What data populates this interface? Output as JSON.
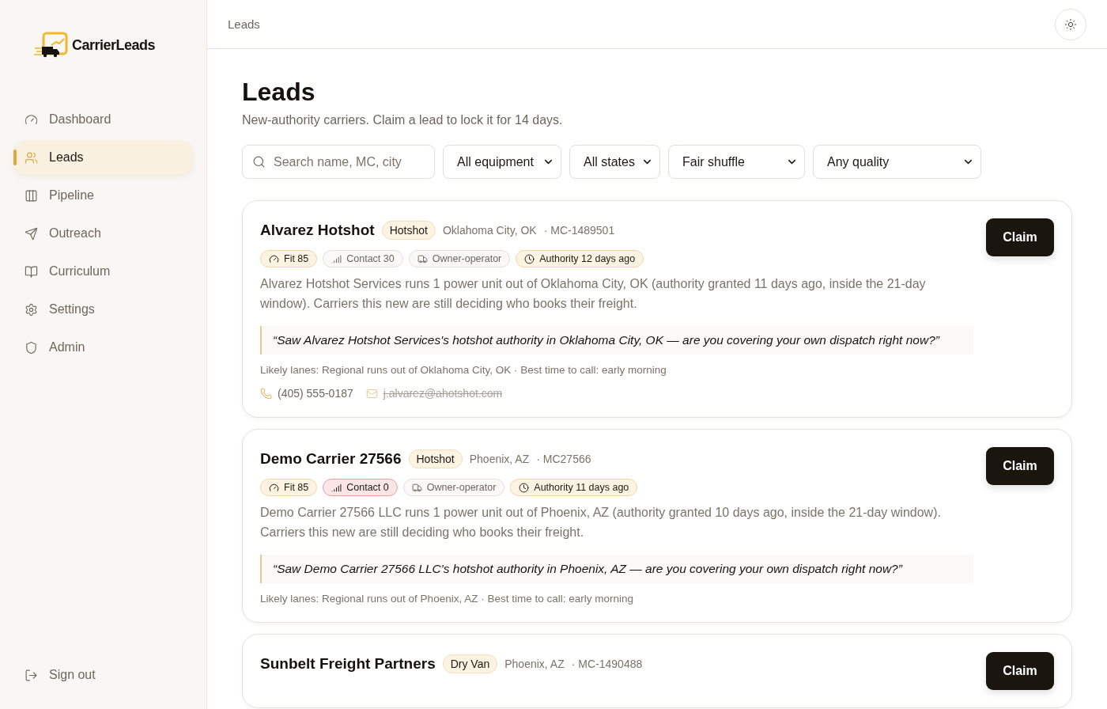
{
  "brand": {
    "name": "CarrierLeads"
  },
  "nav": [
    {
      "label": "Dashboard",
      "selected": false
    },
    {
      "label": "Leads",
      "selected": true
    },
    {
      "label": "Pipeline",
      "selected": false
    },
    {
      "label": "Outreach",
      "selected": false
    },
    {
      "label": "Curriculum",
      "selected": false
    },
    {
      "label": "Settings",
      "selected": false
    },
    {
      "label": "Admin",
      "selected": false
    }
  ],
  "sign_out": {
    "label": "Sign out"
  },
  "topbar": {
    "breadcrumb": "Leads"
  },
  "page": {
    "title": "Leads",
    "subtitle": "New-authority carriers. Claim a lead to lock it for 14 days."
  },
  "filters": {
    "search": {
      "placeholder": "Search name, MC, city"
    },
    "selects": [
      {
        "value": "All equipment"
      },
      {
        "value": "All states"
      },
      {
        "value": "Fair shuffle"
      },
      {
        "value": "Any quality"
      }
    ]
  },
  "leads": [
    {
      "name": "Alvarez Hotshot",
      "equipment": "Hotshot",
      "location": "Oklahoma City, OK",
      "mc": "· MC-1489501",
      "action": "Claim",
      "chips": [
        {
          "kind": "fit",
          "label": "Fit 85",
          "color": "#efd8a8"
        },
        {
          "kind": "contact",
          "label": "Contact 30",
          "color": "#e4e0da"
        },
        {
          "kind": "operator",
          "label": "Owner-operator",
          "color": "#e4e0da"
        },
        {
          "kind": "authority",
          "label": "Authority 12 days ago",
          "color": "#efd8a8"
        }
      ],
      "summary": "Alvarez Hotshot Services runs 1 power unit out of Oklahoma City, OK (authority granted 11 days ago, inside the 21-day window). Carriers this new are still deciding who books their freight.",
      "pitch": "“Saw Alvarez Hotshot Services's hotshot authority in Oklahoma City, OK — are you covering your own dispatch right now?”",
      "lanes": "Likely lanes: Regional runs out of Oklahoma City, OK · Best time to call: early morning",
      "phone": "(405) 555-0187",
      "email": {
        "address": "j.alvarez@ahotshot.com",
        "struck": true
      }
    },
    {
      "name": "Demo Carrier 27566",
      "equipment": "Hotshot",
      "location": "Phoenix, AZ",
      "mc": "· MC27566",
      "action": "Claim",
      "chips": [
        {
          "kind": "fit",
          "label": "Fit 85",
          "color": "#efd8a8"
        },
        {
          "kind": "contact",
          "label": "Contact 0",
          "color": "#e89ea3"
        },
        {
          "kind": "operator",
          "label": "Owner-operator",
          "color": "#e4e0da"
        },
        {
          "kind": "authority",
          "label": "Authority 11 days ago",
          "color": "#efd8a8"
        }
      ],
      "summary": "Demo Carrier 27566 LLC runs 1 power unit out of Phoenix, AZ (authority granted 10 days ago, inside the 21-day window). Carriers this new are still deciding who books their freight.",
      "pitch": "“Saw Demo Carrier 27566 LLC's hotshot authority in Phoenix, AZ — are you covering your own dispatch right now?”",
      "lanes": "Likely lanes: Regional runs out of Phoenix, AZ · Best time to call: early morning"
    },
    {
      "name": "Sunbelt Freight Partners",
      "equipment": "Dry Van",
      "location": "Phoenix, AZ",
      "mc": "· MC-1490488",
      "action": "Claim"
    }
  ]
}
